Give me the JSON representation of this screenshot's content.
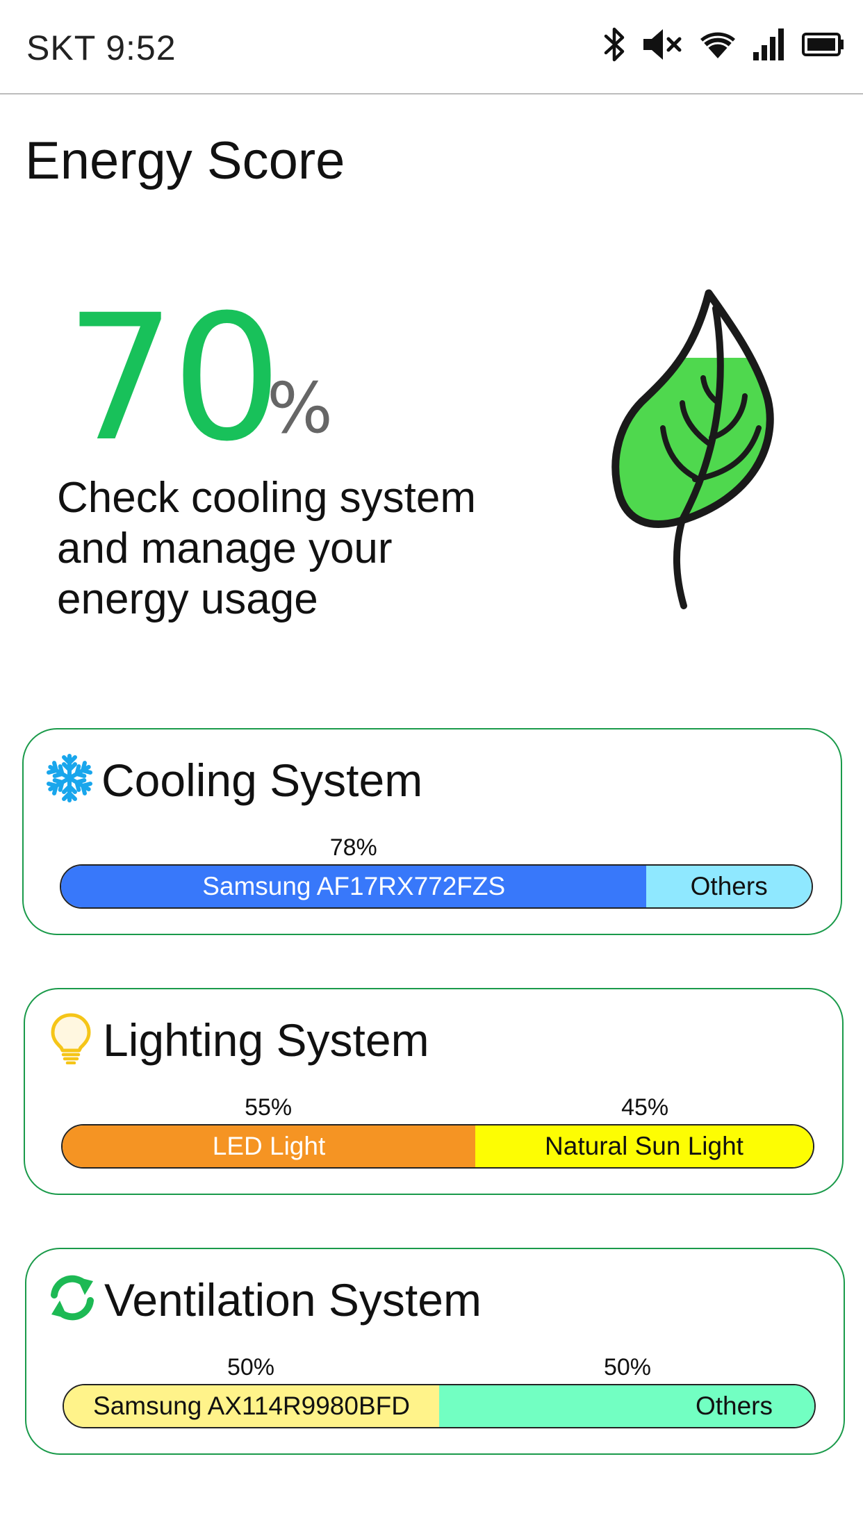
{
  "status_bar": {
    "carrier_time": "SKT 9:52",
    "icons": [
      "bluetooth-icon",
      "mute-icon",
      "wifi-icon",
      "signal-icon",
      "battery-icon"
    ]
  },
  "page": {
    "title": "Energy Score"
  },
  "score": {
    "value": "70",
    "unit": "%",
    "message_lines": [
      "Check cooling system",
      "and manage your",
      "energy  usage"
    ],
    "score_color": "#18c15a",
    "icon": "leaf-icon"
  },
  "cards": {
    "cooling": {
      "title": "Cooling System",
      "icon": "snowflake-icon",
      "segments": [
        {
          "label": "Samsung AF17RX772FZS",
          "percent_text": "78%",
          "share": 0.78,
          "color": "#3878fa",
          "text_color": "#ffffff"
        },
        {
          "label": "Others",
          "share": 0.22,
          "color": "#8fe8ff",
          "text_color": "#111111"
        }
      ]
    },
    "lighting": {
      "title": "Lighting System",
      "icon": "lightbulb-icon",
      "segments": [
        {
          "label": "LED Light",
          "percent_text": "55%",
          "share": 0.55,
          "color": "#f59423",
          "text_color": "#ffffff"
        },
        {
          "label": "Natural Sun Light",
          "percent_text": "45%",
          "share": 0.45,
          "color": "#fdfd03",
          "text_color": "#111111"
        }
      ]
    },
    "ventilation": {
      "title": "Ventilation System",
      "icon": "refresh-arrows-icon",
      "segments": [
        {
          "label": "Samsung AX114R9980BFD",
          "percent_text": "50%",
          "share": 0.5,
          "color": "#fff38a",
          "text_color": "#111111"
        },
        {
          "label": "Others",
          "percent_text": "50%",
          "share": 0.5,
          "color": "#72ffc2",
          "text_color": "#111111"
        }
      ]
    }
  }
}
